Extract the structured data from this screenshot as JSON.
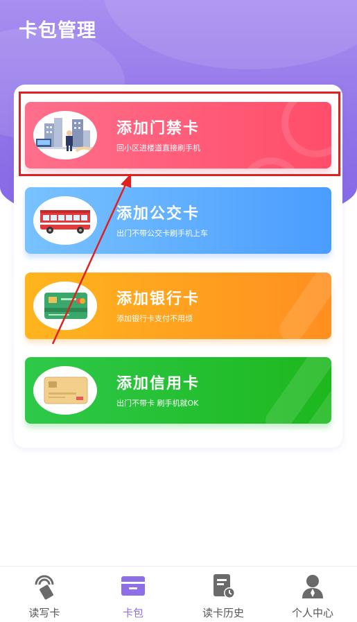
{
  "header": {
    "title": "卡包管理"
  },
  "cards": [
    {
      "title": "添加门禁卡",
      "subtitle": "回小区进楼道直接刷手机",
      "color": "#ff5470",
      "icon": "building-guard-illustration"
    },
    {
      "title": "添加公交卡",
      "subtitle": "出门不带公交卡刷手机上车",
      "color": "#5aa8ff",
      "icon": "bus-illustration"
    },
    {
      "title": "添加银行卡",
      "subtitle": "添加银行卡支付不用烦",
      "color": "#ff9f20",
      "icon": "bank-card-illustration"
    },
    {
      "title": "添加信用卡",
      "subtitle": "出门不带卡 刷手机就OK",
      "color": "#25bf35",
      "icon": "credit-card-illustration"
    }
  ],
  "tabbar": {
    "items": [
      {
        "label": "读写卡",
        "icon": "nfc-card-icon",
        "active": false
      },
      {
        "label": "卡包",
        "icon": "wallet-icon",
        "active": true
      },
      {
        "label": "读卡历史",
        "icon": "history-doc-icon",
        "active": false
      },
      {
        "label": "个人中心",
        "icon": "user-icon",
        "active": false
      }
    ],
    "active_color": "#8f6fe6",
    "inactive_color": "#555555"
  },
  "annotation": {
    "highlight_color": "#e02020"
  }
}
